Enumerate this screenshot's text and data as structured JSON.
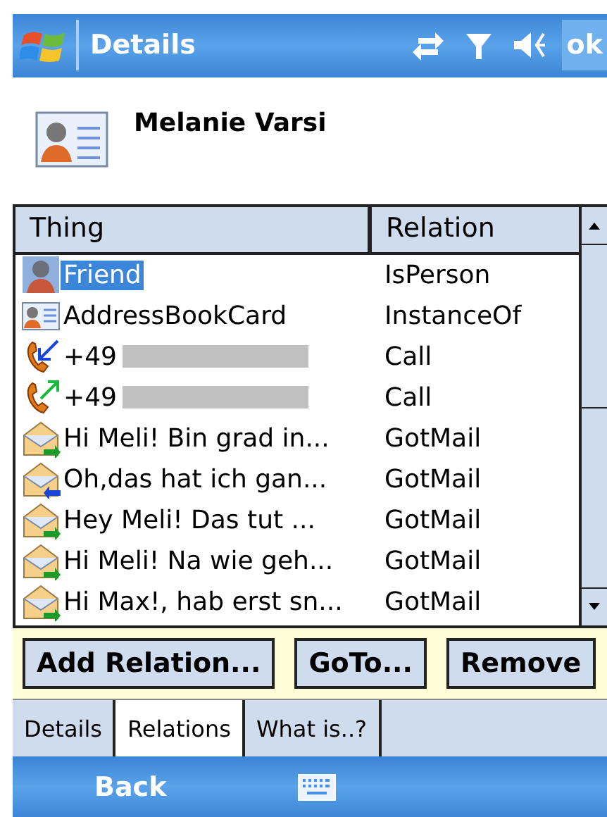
{
  "title_bar": {
    "title": "Details",
    "ok": "ok"
  },
  "contact": {
    "name": "Melanie Varsi"
  },
  "table": {
    "columns": [
      "Thing",
      "Relation"
    ],
    "rows": [
      {
        "kind": "friend",
        "thing": "Friend",
        "relation": "IsPerson",
        "selected": true
      },
      {
        "kind": "card",
        "thing": "AddressBookCard",
        "relation": "InstanceOf",
        "selected": false
      },
      {
        "kind": "call_in",
        "thing": "+49",
        "redacted": true,
        "relation": "Call",
        "selected": false
      },
      {
        "kind": "call_out",
        "thing": "+49",
        "redacted": true,
        "relation": "Call",
        "selected": false
      },
      {
        "kind": "mail_out",
        "thing": "Hi Meli! Bin grad in...",
        "relation": "GotMail",
        "selected": false
      },
      {
        "kind": "mail_in",
        "thing": "Oh,das hat ich gan...",
        "relation": "GotMail",
        "selected": false
      },
      {
        "kind": "mail_out",
        "thing": "Hey Meli! Das tut ...",
        "relation": "GotMail",
        "selected": false
      },
      {
        "kind": "mail_out",
        "thing": "Hi Meli! Na wie geh...",
        "relation": "GotMail",
        "selected": false
      },
      {
        "kind": "mail_out",
        "thing": "Hi Max!, hab erst sn...",
        "relation": "GotMail",
        "selected": false
      }
    ]
  },
  "buttons": [
    "Add Relation...",
    "GoTo...",
    "Remove"
  ],
  "tabs": [
    {
      "label": "Details",
      "selected": false
    },
    {
      "label": "Relations",
      "selected": true
    },
    {
      "label": "What is..?",
      "selected": false
    }
  ],
  "softkeys": {
    "left": "Back"
  }
}
